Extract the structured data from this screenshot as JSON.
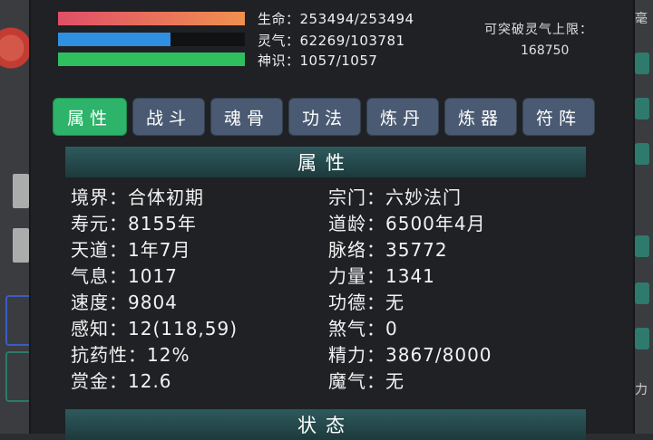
{
  "status": {
    "hp_label": "生命：",
    "hp_value": "253494/253494",
    "hp_fraction": 1.0,
    "qi_label": "灵气：",
    "qi_value": "62269/103781",
    "qi_fraction": 0.6,
    "sense_label": "神识：",
    "sense_value": "1057/1057",
    "sense_fraction": 1.0,
    "limit_title": "可突破灵气上限：",
    "limit_value": "168750"
  },
  "tabs": [
    {
      "label": "属性",
      "active": true
    },
    {
      "label": "战斗",
      "active": false
    },
    {
      "label": "魂骨",
      "active": false
    },
    {
      "label": "功法",
      "active": false
    },
    {
      "label": "炼丹",
      "active": false
    },
    {
      "label": "炼器",
      "active": false
    },
    {
      "label": "符阵",
      "active": false
    }
  ],
  "attributes_section": {
    "title": "属性",
    "left": [
      {
        "label": "境界：",
        "value": "合体初期"
      },
      {
        "label": "寿元：",
        "value": "8155年"
      },
      {
        "label": "天道：",
        "value": "1年7月"
      },
      {
        "label": "气息：",
        "value": "1017"
      },
      {
        "label": "速度：",
        "value": "9804"
      },
      {
        "label": "感知：",
        "value": "12(118,59)"
      },
      {
        "label": "抗药性：",
        "value": "12%"
      },
      {
        "label": "赏金：",
        "value": "12.6"
      }
    ],
    "right": [
      {
        "label": "宗门：",
        "value": "六妙法门"
      },
      {
        "label": "道龄：",
        "value": "6500年4月"
      },
      {
        "label": "脉络：",
        "value": "35772"
      },
      {
        "label": "力量：",
        "value": "1341"
      },
      {
        "label": "功德：",
        "value": "无"
      },
      {
        "label": "煞气：",
        "value": "0"
      },
      {
        "label": "精力：",
        "value": "3867/8000"
      },
      {
        "label": "魔气：",
        "value": "无"
      }
    ]
  },
  "state_section": {
    "title": "状态"
  },
  "side": {
    "right_glyph_top": "毫",
    "right_glyph_bottom": "力"
  },
  "colors": {
    "active_tab": "#2db36a",
    "inactive_tab": "#4a5a72",
    "hp_bar": "#e04f68",
    "qi_bar": "#2f8fe0",
    "sense_bar": "#2fbf5f"
  }
}
